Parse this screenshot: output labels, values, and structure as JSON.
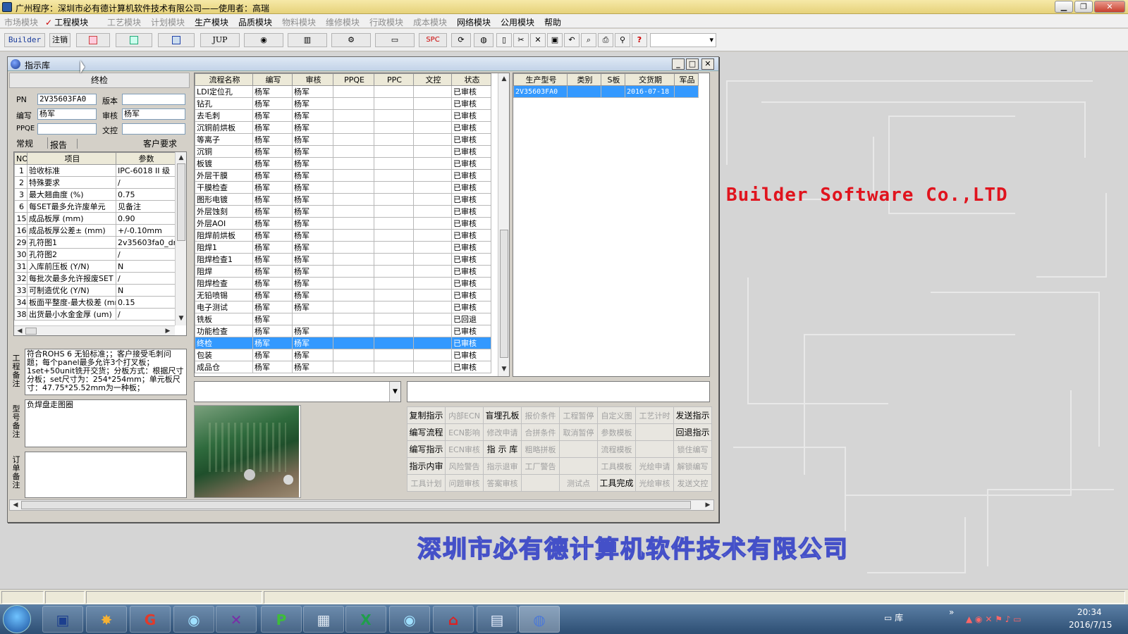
{
  "titlebar": {
    "title": "广州程序：深圳市必有德计算机软件技术有限公司——使用者：高瑞"
  },
  "menu": [
    {
      "label": "市场模块",
      "enabled": false
    },
    {
      "label": "工程模块",
      "enabled": true,
      "checked": true
    },
    {
      "label": "工艺模块",
      "enabled": false
    },
    {
      "label": "计划模块",
      "enabled": false
    },
    {
      "label": "生产模块",
      "enabled": true
    },
    {
      "label": "品质模块",
      "enabled": true
    },
    {
      "label": "物料模块",
      "enabled": false
    },
    {
      "label": "维修模块",
      "enabled": false
    },
    {
      "label": "行政模块",
      "enabled": false
    },
    {
      "label": "成本模块",
      "enabled": false
    },
    {
      "label": "网络模块",
      "enabled": true
    },
    {
      "label": "公用模块",
      "enabled": true
    },
    {
      "label": "帮助",
      "enabled": true
    }
  ],
  "toolbar": {
    "builder": "Builder",
    "logout": "注销",
    "jup": "JUP",
    "spc": "SPC",
    "help": "?"
  },
  "window": {
    "title": "指示库",
    "section": "终检"
  },
  "form": {
    "pn_label": "PN",
    "pn": "2V35603FA0",
    "version_label": "版本",
    "version": "",
    "writer_label": "编写",
    "writer": "杨军",
    "review_label": "审核",
    "reviewer": "杨军",
    "ppqe_label": "PPQE",
    "ppqe": "",
    "doc_label": "文控",
    "doc": ""
  },
  "tabs": {
    "normal": "常规",
    "report": "报告",
    "customer": "客户要求"
  },
  "params": {
    "headers": [
      "NO",
      "项目",
      "参数"
    ],
    "rows": [
      [
        "1",
        "验收标准",
        "IPC-6018 II 级"
      ],
      [
        "2",
        "特殊要求",
        "/"
      ],
      [
        "3",
        "最大翘曲度 (%)",
        "0.75"
      ],
      [
        "6",
        "每SET最多允许废单元",
        "见备注"
      ],
      [
        "15",
        "成品板厚 (mm)",
        "0.90"
      ],
      [
        "16",
        "成品板厚公差± (mm)",
        "+/-0.10mm"
      ],
      [
        "29",
        "孔符图1",
        "2v35603fa0_dr"
      ],
      [
        "30",
        "孔符图2",
        "/"
      ],
      [
        "31",
        "入库前压板 (Y/N)",
        "N"
      ],
      [
        "32",
        "每批次最多允许报废SET",
        "/"
      ],
      [
        "33",
        "可制造优化 (Y/N)",
        "N"
      ],
      [
        "34",
        "板面平整度-最大极差 (mm",
        "0.15"
      ],
      [
        "38",
        "出货最小水金金厚 (um)",
        "/"
      ]
    ]
  },
  "memos": {
    "eng_label": "工程备注",
    "eng_text": "符合ROHS 6 无铅标准；；客户接受毛刺问题；每个panel最多允许3个打叉板；1set+50unit铣开交货；分板方式：根据尺寸分板；set尺寸为：254*254mm；单元板尺寸：47.75*25.52mm为一种板；",
    "model_label": "型号备注",
    "model_text": "负焊盘走图圈",
    "order_label": "订单备注",
    "order_text": ""
  },
  "process": {
    "headers": [
      "流程名称",
      "编写",
      "审核",
      "PPQE",
      "PPC",
      "文控",
      "状态"
    ],
    "rows": [
      [
        "LDI定位孔",
        "杨军",
        "杨军",
        "",
        "",
        "",
        "已审核"
      ],
      [
        "钻孔",
        "杨军",
        "杨军",
        "",
        "",
        "",
        "已审核"
      ],
      [
        "去毛刺",
        "杨军",
        "杨军",
        "",
        "",
        "",
        "已审核"
      ],
      [
        "沉铜前烘板",
        "杨军",
        "杨军",
        "",
        "",
        "",
        "已审核"
      ],
      [
        "等离子",
        "杨军",
        "杨军",
        "",
        "",
        "",
        "已审核"
      ],
      [
        "沉铜",
        "杨军",
        "杨军",
        "",
        "",
        "",
        "已审核"
      ],
      [
        "板镀",
        "杨军",
        "杨军",
        "",
        "",
        "",
        "已审核"
      ],
      [
        "外层干膜",
        "杨军",
        "杨军",
        "",
        "",
        "",
        "已审核"
      ],
      [
        "干膜检查",
        "杨军",
        "杨军",
        "",
        "",
        "",
        "已审核"
      ],
      [
        "图形电镀",
        "杨军",
        "杨军",
        "",
        "",
        "",
        "已审核"
      ],
      [
        "外层蚀刻",
        "杨军",
        "杨军",
        "",
        "",
        "",
        "已审核"
      ],
      [
        "外层AOI",
        "杨军",
        "杨军",
        "",
        "",
        "",
        "已审核"
      ],
      [
        "阻焊前烘板",
        "杨军",
        "杨军",
        "",
        "",
        "",
        "已审核"
      ],
      [
        "阻焊1",
        "杨军",
        "杨军",
        "",
        "",
        "",
        "已审核"
      ],
      [
        "阻焊检查1",
        "杨军",
        "杨军",
        "",
        "",
        "",
        "已审核"
      ],
      [
        "阻焊",
        "杨军",
        "杨军",
        "",
        "",
        "",
        "已审核"
      ],
      [
        "阻焊检查",
        "杨军",
        "杨军",
        "",
        "",
        "",
        "已审核"
      ],
      [
        "无铅喷锡",
        "杨军",
        "杨军",
        "",
        "",
        "",
        "已审核"
      ],
      [
        "电子测试",
        "杨军",
        "杨军",
        "",
        "",
        "",
        "已审核"
      ],
      [
        "铣板",
        "杨军",
        "",
        "",
        "",
        "",
        "已回退"
      ],
      [
        "功能检查",
        "杨军",
        "杨军",
        "",
        "",
        "",
        "已审核"
      ],
      [
        "终检",
        "杨军",
        "杨军",
        "",
        "",
        "",
        "已审核"
      ],
      [
        "包装",
        "杨军",
        "杨军",
        "",
        "",
        "",
        "已审核"
      ],
      [
        "成品仓",
        "杨军",
        "杨军",
        "",
        "",
        "",
        "已审核"
      ]
    ],
    "selected_index": 21
  },
  "models": {
    "headers": [
      "生产型号",
      "类别",
      "S板",
      "交货期",
      "军品"
    ],
    "rows": [
      [
        "2V35603FA0",
        "",
        "",
        "2016-07-18",
        ""
      ]
    ]
  },
  "buttons": [
    [
      {
        "label": "复制指示",
        "on": true
      },
      {
        "label": "内部ECN",
        "on": false
      },
      {
        "label": "盲埋孔板",
        "on": true
      },
      {
        "label": "报价条件",
        "on": false
      },
      {
        "label": "工程暂停",
        "on": false
      },
      {
        "label": "自定义图",
        "on": false
      },
      {
        "label": "工艺计时",
        "on": false
      },
      {
        "label": "发送指示",
        "on": true
      }
    ],
    [
      {
        "label": "编写流程",
        "on": true
      },
      {
        "label": "ECN影响",
        "on": false
      },
      {
        "label": "修改申请",
        "on": false
      },
      {
        "label": "合拼条件",
        "on": false
      },
      {
        "label": "取消暂停",
        "on": false
      },
      {
        "label": "参数模板",
        "on": false
      },
      {
        "label": "",
        "on": false
      },
      {
        "label": "回退指示",
        "on": true
      }
    ],
    [
      {
        "label": "编写指示",
        "on": true
      },
      {
        "label": "ECN审核",
        "on": false
      },
      {
        "label": "指 示 库",
        "on": true
      },
      {
        "label": "粗略拼板",
        "on": false
      },
      {
        "label": "",
        "on": false
      },
      {
        "label": "流程模板",
        "on": false
      },
      {
        "label": "",
        "on": false
      },
      {
        "label": "锁住编写",
        "on": false
      }
    ],
    [
      {
        "label": "指示内审",
        "on": true
      },
      {
        "label": "风险警告",
        "on": false
      },
      {
        "label": "指示退审",
        "on": false
      },
      {
        "label": "工厂警告",
        "on": false
      },
      {
        "label": "",
        "on": false
      },
      {
        "label": "工具模板",
        "on": false
      },
      {
        "label": "光绘申请",
        "on": false
      },
      {
        "label": "解锁编写",
        "on": false
      }
    ],
    [
      {
        "label": "工具计划",
        "on": false
      },
      {
        "label": "问题审核",
        "on": false
      },
      {
        "label": "答案审核",
        "on": false
      },
      {
        "label": "",
        "on": false
      },
      {
        "label": "测试点",
        "on": false
      },
      {
        "label": "工具完成",
        "on": true
      },
      {
        "label": "光绘审核",
        "on": false
      },
      {
        "label": "发送文控",
        "on": false
      }
    ]
  ],
  "desktop": {
    "company_en": "Builder Software Co.,LTD",
    "company_cn": "深圳市必有德计算机软件技术有限公司"
  },
  "taskbar": {
    "folder_label": "库",
    "time": "20:34",
    "date": "2016/7/15"
  },
  "colors": {
    "selection": "#3399ff",
    "brand_red": "#e0141e",
    "company_blue": "#4450c8"
  }
}
